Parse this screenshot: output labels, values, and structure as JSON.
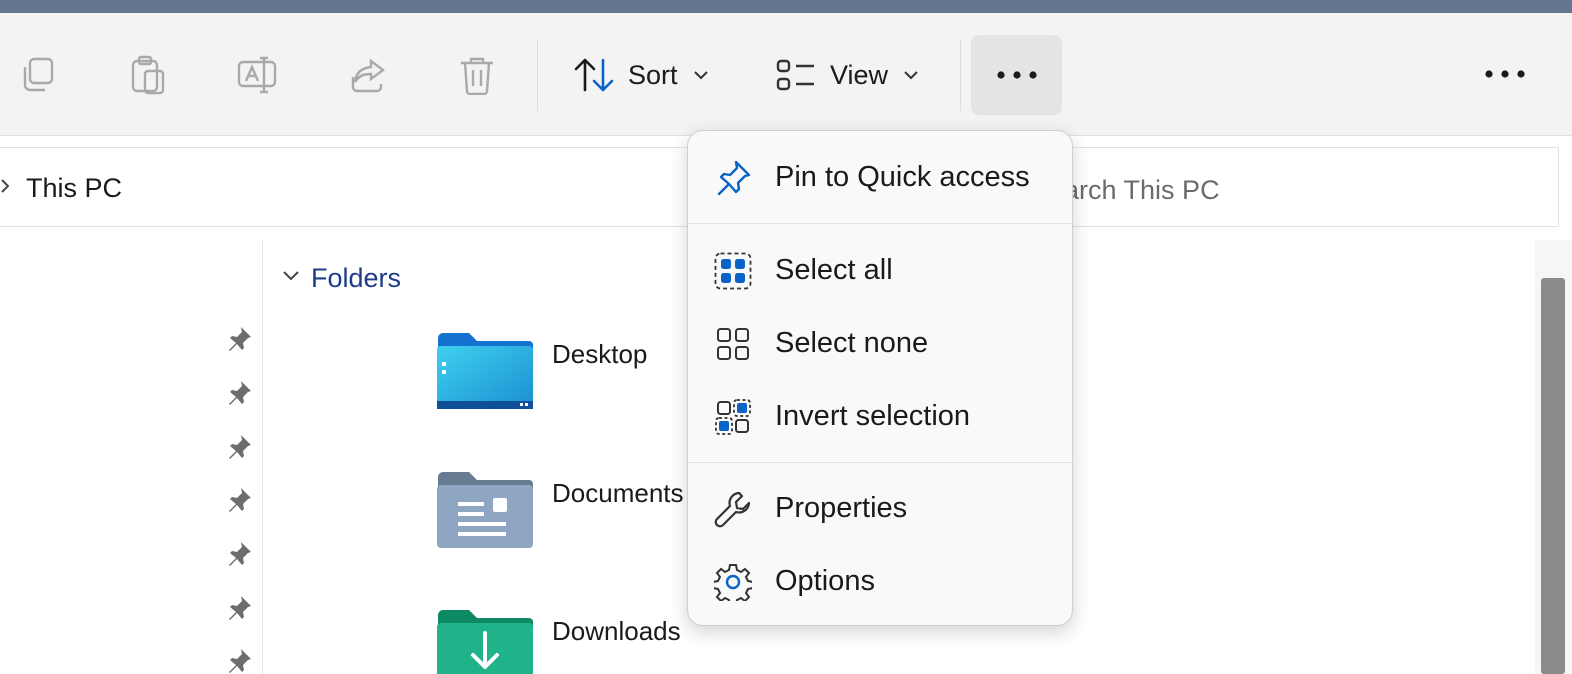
{
  "toolbar": {
    "sort_label": "Sort",
    "view_label": "View"
  },
  "address": {
    "location": "This PC",
    "search_placeholder": "Search This PC",
    "search_visible_text": "earch This PC"
  },
  "content": {
    "group_label": "Folders",
    "folders": [
      {
        "name": "Desktop",
        "color": "#2ba6e0"
      },
      {
        "name": "Documents",
        "color": "#8ea6c2"
      },
      {
        "name": "Downloads",
        "color": "#20b38a"
      }
    ]
  },
  "context_menu": {
    "items": [
      {
        "label": "Pin to Quick access",
        "icon": "pin-icon"
      },
      {
        "label": "Select all",
        "icon": "select-all-icon"
      },
      {
        "label": "Select none",
        "icon": "select-none-icon"
      },
      {
        "label": "Invert selection",
        "icon": "invert-selection-icon"
      },
      {
        "label": "Properties",
        "icon": "wrench-icon"
      },
      {
        "label": "Options",
        "icon": "gear-icon"
      }
    ]
  },
  "colors": {
    "accent": "#0a64c8",
    "title_strip": "#657691",
    "toolbar_bg": "#f3f3f3"
  }
}
